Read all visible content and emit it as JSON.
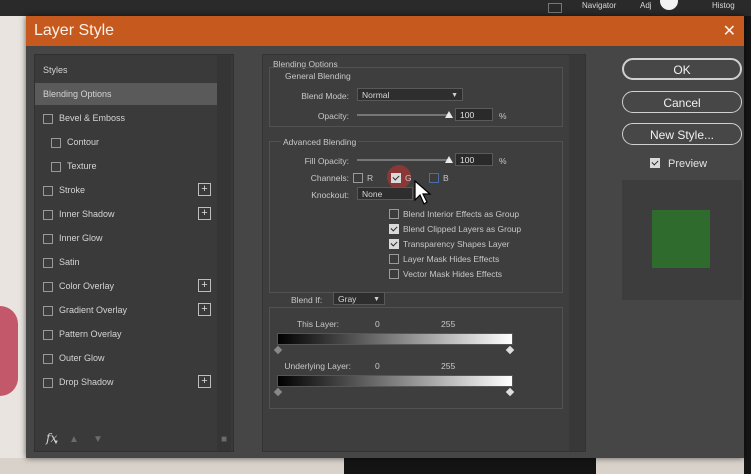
{
  "window": {
    "title": "Layer Style",
    "top_strip": [
      "Navigator",
      "Adj",
      "Histog"
    ]
  },
  "styles_panel": {
    "header": "Styles",
    "items": [
      {
        "label": "Blending Options",
        "has_checkbox": false,
        "checked": false,
        "has_add": false,
        "active": true
      },
      {
        "label": "Bevel & Emboss",
        "has_checkbox": true,
        "checked": false,
        "has_add": false
      },
      {
        "label": "Contour",
        "has_checkbox": true,
        "checked": false,
        "has_add": false,
        "indent": true
      },
      {
        "label": "Texture",
        "has_checkbox": true,
        "checked": false,
        "has_add": false,
        "indent": true
      },
      {
        "label": "Stroke",
        "has_checkbox": true,
        "checked": false,
        "has_add": true
      },
      {
        "label": "Inner Shadow",
        "has_checkbox": true,
        "checked": false,
        "has_add": true
      },
      {
        "label": "Inner Glow",
        "has_checkbox": true,
        "checked": false,
        "has_add": false
      },
      {
        "label": "Satin",
        "has_checkbox": true,
        "checked": false,
        "has_add": false
      },
      {
        "label": "Color Overlay",
        "has_checkbox": true,
        "checked": false,
        "has_add": true
      },
      {
        "label": "Gradient Overlay",
        "has_checkbox": true,
        "checked": false,
        "has_add": true
      },
      {
        "label": "Pattern Overlay",
        "has_checkbox": true,
        "checked": false,
        "has_add": false
      },
      {
        "label": "Outer Glow",
        "has_checkbox": true,
        "checked": false,
        "has_add": false
      },
      {
        "label": "Drop Shadow",
        "has_checkbox": true,
        "checked": false,
        "has_add": true
      }
    ],
    "footer": {
      "fx": "fx",
      "up_icon": "arrow-up-icon",
      "down_icon": "arrow-down-icon",
      "trash_icon": "trash-icon"
    }
  },
  "blending": {
    "section_title": "Blending Options",
    "general_title": "General Blending",
    "blend_mode_label": "Blend Mode:",
    "blend_mode_value": "Normal",
    "opacity_label": "Opacity:",
    "opacity_value": "100",
    "opacity_unit": "%",
    "opacity_level": 1.0,
    "advanced_title": "Advanced Blending",
    "fill_opacity_label": "Fill Opacity:",
    "fill_opacity_value": "100",
    "fill_opacity_unit": "%",
    "fill_opacity_level": 1.0,
    "channels_label": "Channels:",
    "channels": [
      {
        "label": "R",
        "checked": false
      },
      {
        "label": "G",
        "checked": true
      },
      {
        "label": "B",
        "checked": false
      }
    ],
    "knockout_label": "Knockout:",
    "knockout_value": "None",
    "options": [
      {
        "label": "Blend Interior Effects as Group",
        "checked": false
      },
      {
        "label": "Blend Clipped Layers as Group",
        "checked": true
      },
      {
        "label": "Transparency Shapes Layer",
        "checked": true
      },
      {
        "label": "Layer Mask Hides Effects",
        "checked": false
      },
      {
        "label": "Vector Mask Hides Effects",
        "checked": false
      }
    ],
    "blend_if_label": "Blend If:",
    "blend_if_value": "Gray",
    "this_layer_label": "This Layer:",
    "this_layer_min": "0",
    "this_layer_max": "255",
    "underlying_label": "Underlying Layer:",
    "underlying_min": "0",
    "underlying_max": "255"
  },
  "actions": {
    "ok": "OK",
    "cancel": "Cancel",
    "new_style": "New Style...",
    "preview_label": "Preview",
    "preview_checked": true
  },
  "colors": {
    "titlebar": "#c65a1e",
    "preview_swatch": "#2e6b2c"
  }
}
